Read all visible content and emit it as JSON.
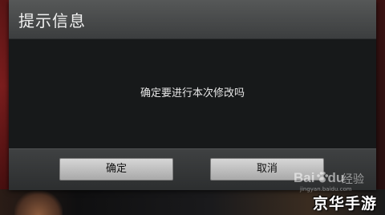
{
  "dialog": {
    "title": "提示信息",
    "message": "确定要进行本次修改吗",
    "ok_label": "确定",
    "cancel_label": "取消"
  },
  "watermark": {
    "baidu": "Bai",
    "baidu_suffix": "du",
    "jingyan": "经验",
    "url": "jingyan.baidu.com",
    "brand": "京华手游"
  },
  "colors": {
    "header_bg": "#4a4c4d",
    "body_bg": "#17191a",
    "footer_bg": "#363839",
    "button_bg": "#c0c0c0"
  }
}
